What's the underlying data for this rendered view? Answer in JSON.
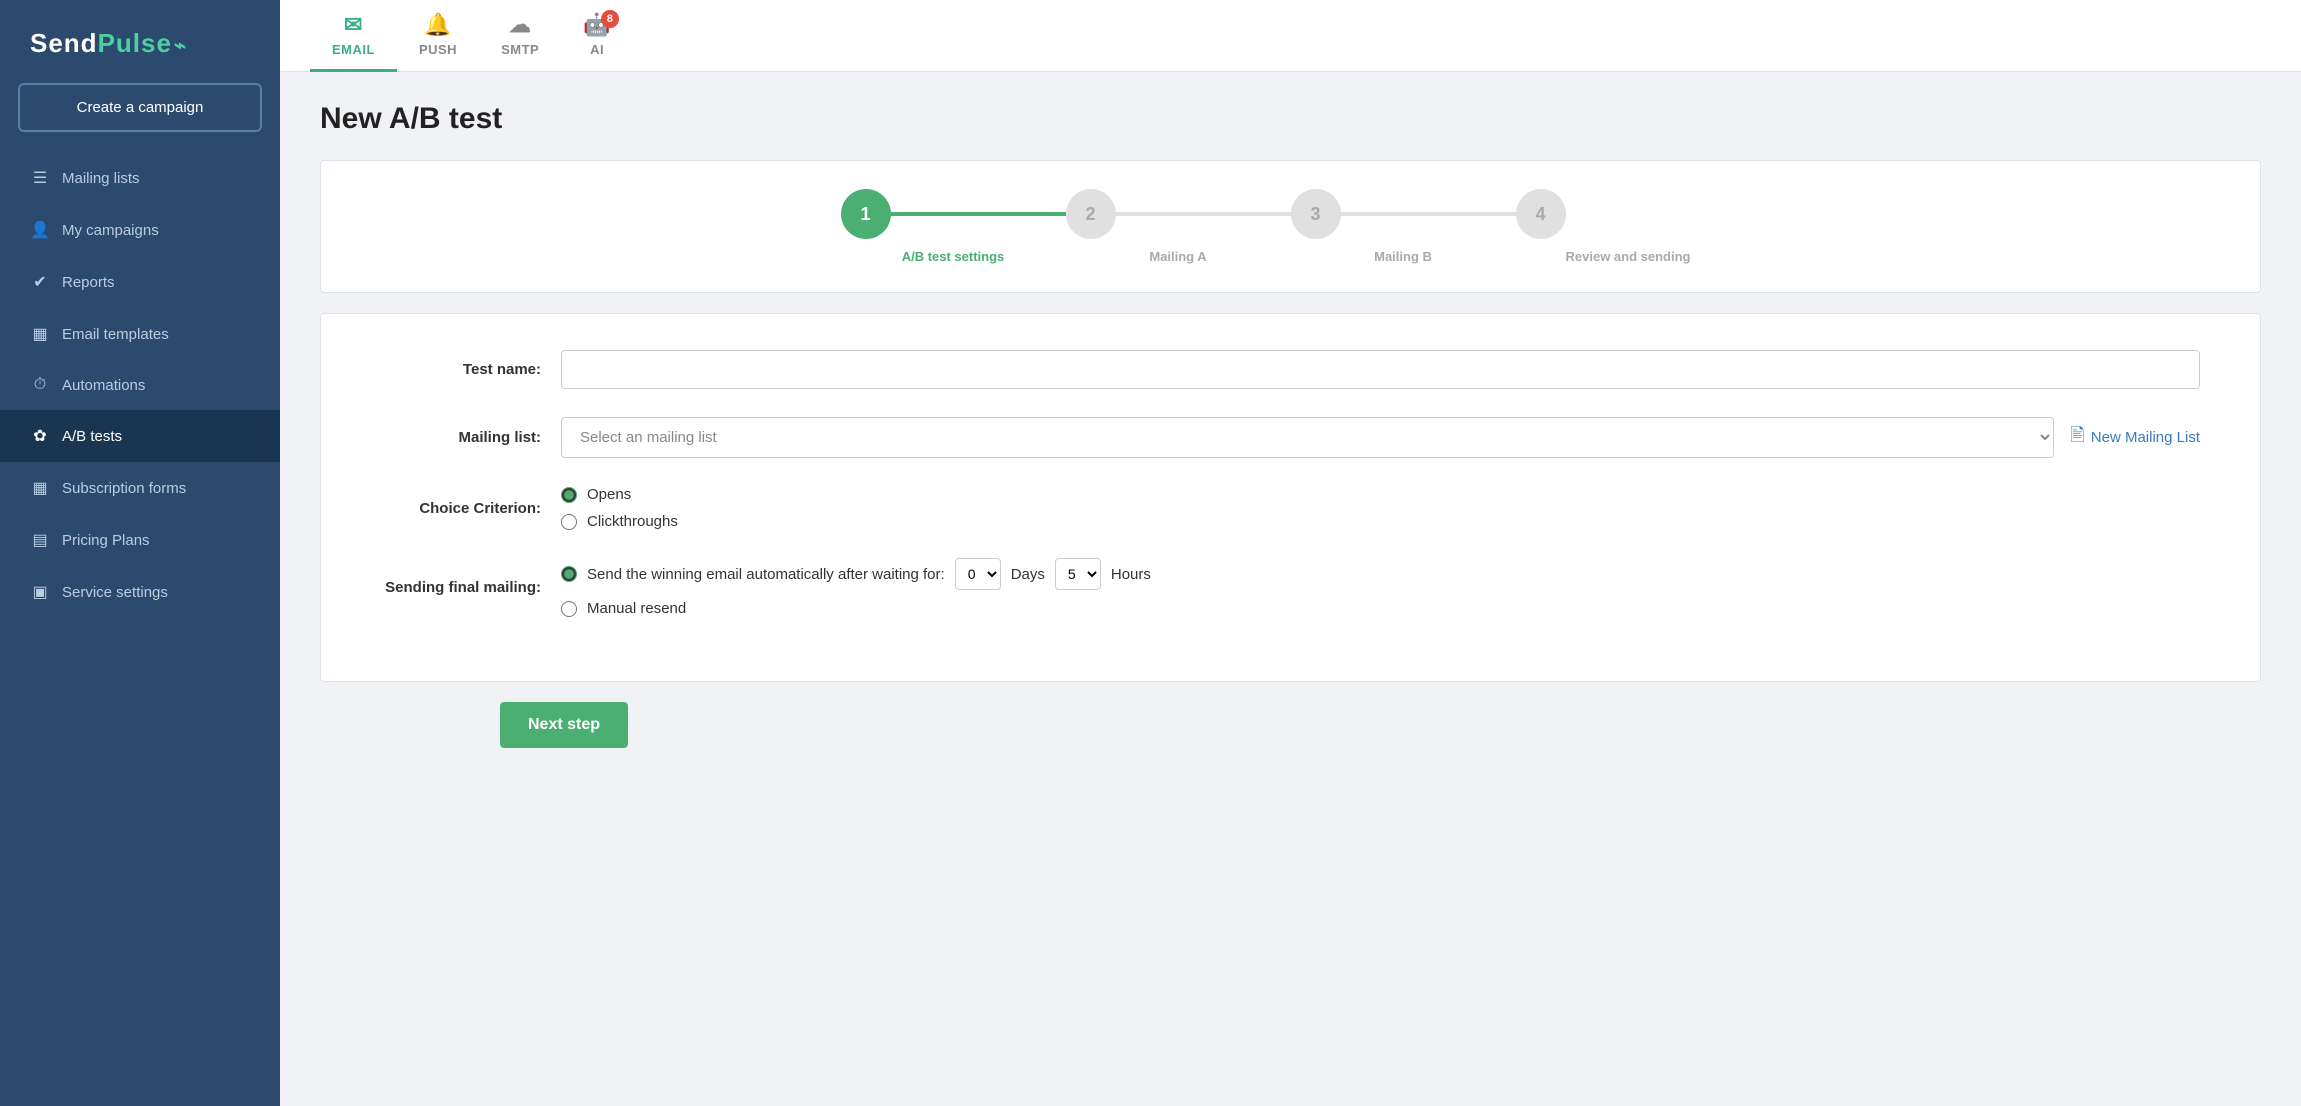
{
  "sidebar": {
    "logo": "SendPulse",
    "logo_symbol": "~",
    "create_campaign_label": "Create a campaign",
    "nav_items": [
      {
        "id": "mailing-lists",
        "label": "Mailing lists",
        "icon": "☰",
        "active": false
      },
      {
        "id": "my-campaigns",
        "label": "My campaigns",
        "icon": "👤",
        "active": false
      },
      {
        "id": "reports",
        "label": "Reports",
        "icon": "✔",
        "active": false
      },
      {
        "id": "email-templates",
        "label": "Email templates",
        "icon": "▦",
        "active": false
      },
      {
        "id": "automations",
        "label": "Automations",
        "icon": "⏱",
        "active": false
      },
      {
        "id": "ab-tests",
        "label": "A/B tests",
        "icon": "✿",
        "active": true
      },
      {
        "id": "subscription-forms",
        "label": "Subscription forms",
        "icon": "▦",
        "active": false
      },
      {
        "id": "pricing-plans",
        "label": "Pricing Plans",
        "icon": "▤",
        "active": false
      },
      {
        "id": "service-settings",
        "label": "Service settings",
        "icon": "▣",
        "active": false
      }
    ]
  },
  "topnav": {
    "items": [
      {
        "id": "email",
        "label": "EMAIL",
        "icon": "✉",
        "active": true,
        "badge": null
      },
      {
        "id": "push",
        "label": "PUSH",
        "icon": "🔔",
        "active": false,
        "badge": null
      },
      {
        "id": "smtp",
        "label": "SMTP",
        "icon": "☁",
        "active": false,
        "badge": null
      },
      {
        "id": "ai",
        "label": "AI",
        "icon": "🤖",
        "active": false,
        "badge": "8"
      }
    ]
  },
  "page": {
    "title": "New A/B test"
  },
  "steps": [
    {
      "number": "1",
      "label": "A/B test settings",
      "active": true
    },
    {
      "number": "2",
      "label": "Mailing A",
      "active": false
    },
    {
      "number": "3",
      "label": "Mailing B",
      "active": false
    },
    {
      "number": "4",
      "label": "Review and sending",
      "active": false
    }
  ],
  "form": {
    "test_name_label": "Test name:",
    "test_name_placeholder": "",
    "mailing_list_label": "Mailing list:",
    "mailing_list_placeholder": "Select an mailing list",
    "new_mailing_list_label": "New Mailing List",
    "choice_criterion_label": "Choice Criterion:",
    "choice_criterion_options": [
      {
        "id": "opens",
        "label": "Opens",
        "checked": true
      },
      {
        "id": "clickthroughs",
        "label": "Clickthroughs",
        "checked": false
      }
    ],
    "sending_final_label": "Sending final mailing:",
    "sending_auto_label": "Send the winning email automatically after waiting for:",
    "sending_days_value": "0",
    "sending_days_label": "Days",
    "sending_hours_value": "5",
    "sending_hours_label": "Hours",
    "sending_manual_label": "Manual resend",
    "next_step_label": "Next step"
  }
}
